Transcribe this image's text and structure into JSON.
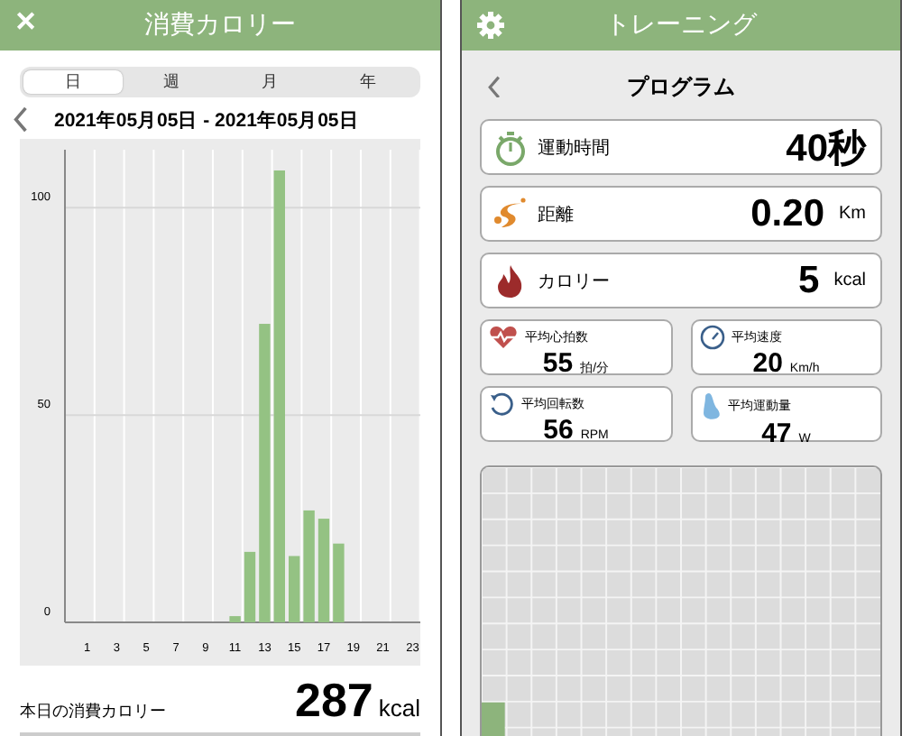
{
  "left_screen": {
    "header": {
      "close": "✕",
      "title": "消費カロリー"
    },
    "tabs": [
      {
        "label": "日",
        "selected": true
      },
      {
        "label": "週",
        "selected": false
      },
      {
        "label": "月",
        "selected": false
      },
      {
        "label": "年",
        "selected": false
      }
    ],
    "date_range": "2021年05月05日 - 2021年05月05日",
    "chart": {
      "chart_data": {
        "type": "bar",
        "x": [
          0,
          1,
          2,
          3,
          4,
          5,
          6,
          7,
          8,
          9,
          10,
          11,
          12,
          13,
          14,
          15,
          16,
          17,
          18,
          19,
          20,
          21,
          22,
          23
        ],
        "series": [
          {
            "color": "#94c283",
            "values": [
              0,
              0,
              0,
              0,
              0,
              0,
              0,
              0,
              0,
              0,
              0,
              1.5,
              17,
              72,
              109,
              16,
              27,
              25,
              19,
              0,
              0,
              0,
              0,
              0
            ]
          }
        ],
        "xticks": [
          1,
          3,
          5,
          7,
          9,
          11,
          13,
          15,
          17,
          19,
          21,
          23
        ],
        "xlim": [
          -0.5,
          23.5
        ],
        "yticks": [
          0,
          50,
          100
        ],
        "ylim": [
          0,
          114
        ]
      }
    },
    "summary": {
      "label": "本日の消費カロリー",
      "value": "287",
      "unit": "kcal"
    }
  },
  "right_screen": {
    "header": {
      "title": "トレーニング"
    },
    "subtitle": "プログラム",
    "metrics": [
      {
        "kind": "time",
        "label": "運動時間",
        "value": "40秒"
      },
      {
        "kind": "distance",
        "label": "距離",
        "value": "0.20",
        "unit": "Km"
      },
      {
        "kind": "calorie",
        "label": "カロリー",
        "value": "5",
        "unit": "kcal"
      }
    ],
    "averages": [
      {
        "kind": "heart",
        "label": "平均心拍数",
        "value": "55",
        "unit": "拍/分"
      },
      {
        "kind": "speed",
        "label": "平均速度",
        "value": "20",
        "unit": "Km/h"
      },
      {
        "kind": "rpm",
        "label": "平均回転数",
        "value": "56",
        "unit": "RPM"
      },
      {
        "kind": "power",
        "label": "平均運動量",
        "value": "47",
        "unit": "W"
      }
    ]
  }
}
